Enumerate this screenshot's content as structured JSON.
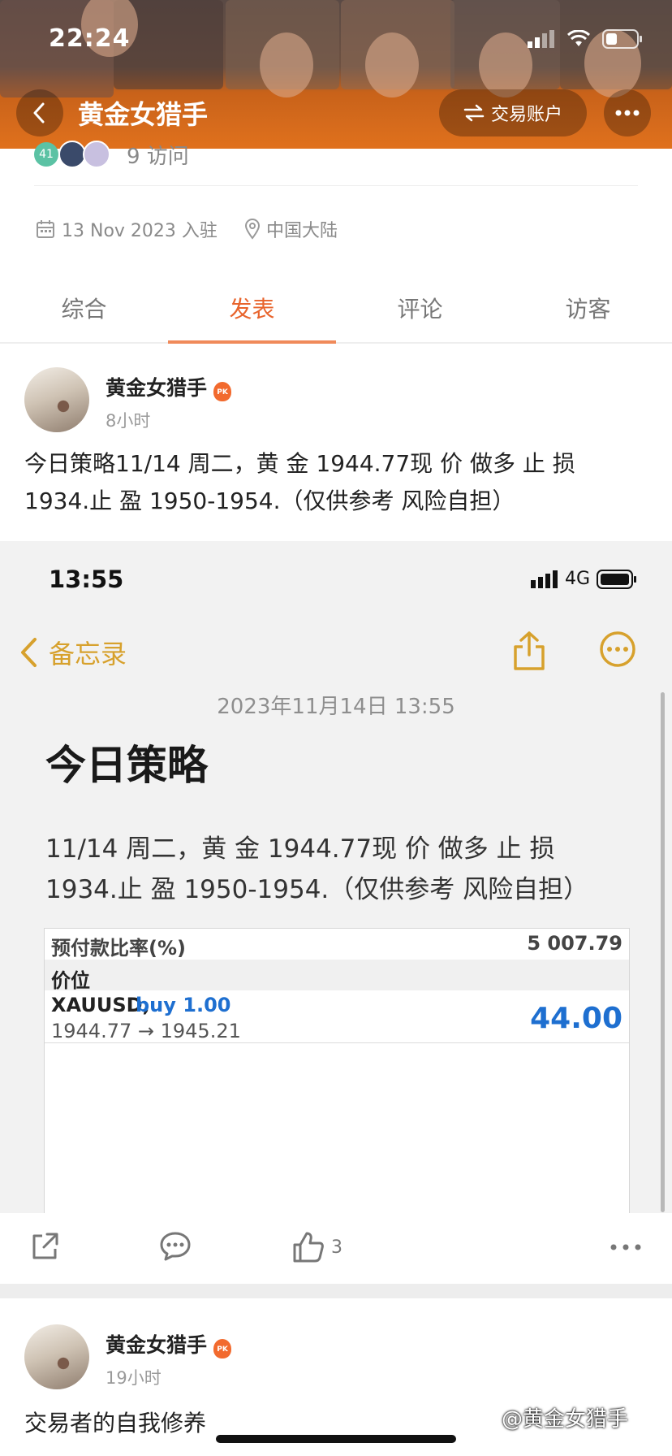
{
  "status_bar": {
    "time": "22:24"
  },
  "header": {
    "title": "黄金女猎手",
    "trade_label": "交易账户"
  },
  "profile": {
    "badge_count": "41",
    "visits": "9 访问",
    "join_date": "13 Nov 2023 入驻",
    "location": "中国大陆"
  },
  "tabs": [
    {
      "label": "综合",
      "active": false
    },
    {
      "label": "发表",
      "active": true
    },
    {
      "label": "评论",
      "active": false
    },
    {
      "label": "访客",
      "active": false
    }
  ],
  "posts": [
    {
      "author": "黄金女猎手",
      "badge": "PK",
      "time": "8小时",
      "text_line1": "今日策略11/14 周二，黄 金 1944.77现 价 做多 止 损",
      "text_line2": "1934.止 盈 1950-1954.（仅供参考 风险自担）",
      "likes": "3"
    },
    {
      "author": "黄金女猎手",
      "badge": "PK",
      "time": "19小时",
      "text": "交易者的自我修养"
    }
  ],
  "embedded": {
    "time": "13:55",
    "network": "4G",
    "back_label": "备忘录",
    "date": "2023年11月14日 13:55",
    "title": "今日策略",
    "body_line1": "11/14 周二，黄 金 1944.77现 价 做多 止 损",
    "body_line2": "1934.止 盈 1950-1954.（仅供参考 风险自担）",
    "table": {
      "ratio_label": "预付款比率(%)",
      "ratio_value": "5 007.79",
      "section_label": "价位",
      "symbol": "XAUUSD,",
      "order": "buy 1.00",
      "prices": "1944.77 → 1945.21",
      "profit": "44.00"
    }
  },
  "watermark": "@黄金女猎手",
  "colors": {
    "accent": "#e8642c",
    "notes_yellow": "#d7a12d",
    "profit_blue": "#1e6fd0"
  }
}
